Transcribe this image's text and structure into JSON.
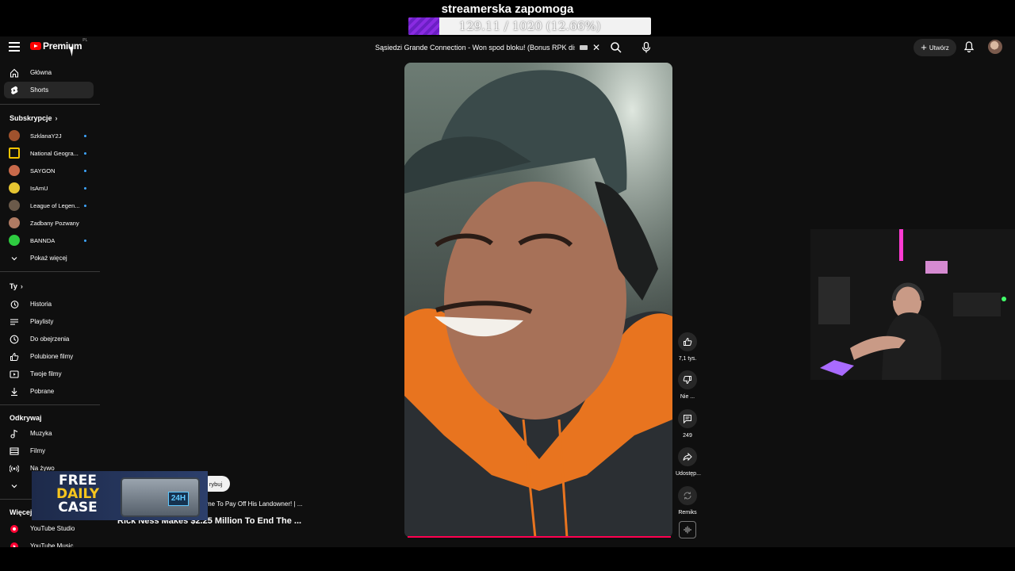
{
  "overlay": {
    "goal_title": "streamerska zapomoga",
    "goal_text": "129.11 / 1020 (12.66%)",
    "goal_progress": 0.1266,
    "fill_color": "#8a2be2"
  },
  "header": {
    "logo_text": "Premium",
    "logo_country": "PL",
    "search_value": "Sąsiedzi Grande Connection - Won spod bloku! (Bonus RPK diss)",
    "clear_symbol": "✕",
    "create_label": "Utwórz",
    "create_plus": "+"
  },
  "sidebar": {
    "main_items": [
      {
        "label": "Główna",
        "icon": "home-icon"
      },
      {
        "label": "Shorts",
        "icon": "shorts-icon",
        "active": true
      }
    ],
    "subs_heading": "Subskrypcje",
    "subscriptions": [
      {
        "name": "SzklanaY2J",
        "color": "#a0522d"
      },
      {
        "name": "National Geogra...",
        "color": "#f5c400"
      },
      {
        "name": "SAYGON",
        "color": "#c96a4a"
      },
      {
        "name": "IsAmU",
        "color": "#e6c531"
      },
      {
        "name": "League of Legen...",
        "color": "#6b5a4a"
      },
      {
        "name": "Zadbany Pozwany",
        "color": "#b07b63"
      },
      {
        "name": "BANNDA",
        "color": "#2ecc40"
      }
    ],
    "show_more": "Pokaż więcej",
    "you_heading": "Ty",
    "you_items": [
      {
        "label": "Historia",
        "icon": "history-icon"
      },
      {
        "label": "Playlisty",
        "icon": "playlist-icon"
      },
      {
        "label": "Do obejrzenia",
        "icon": "watch-later-icon"
      },
      {
        "label": "Polubione filmy",
        "icon": "like-icon"
      },
      {
        "label": "Twoje filmy",
        "icon": "your-videos-icon"
      },
      {
        "label": "Pobrane",
        "icon": "download-icon"
      }
    ],
    "explore_heading": "Odkrywaj",
    "explore_items": [
      {
        "label": "Muzyka",
        "icon": "music-icon"
      },
      {
        "label": "Filmy",
        "icon": "movies-icon"
      },
      {
        "label": "Na żywo",
        "icon": "live-icon"
      }
    ],
    "more_heading": "Więcej",
    "more_items": [
      {
        "label": "YouTube Studio",
        "icon": "yt-studio-icon"
      },
      {
        "label": "YouTube Music",
        "icon": "yt-music-icon"
      }
    ]
  },
  "actions": {
    "likes": "7,1 tys.",
    "dislike": "Nie ...",
    "comments": "249",
    "share": "Udostęp...",
    "remix": "Remiks"
  },
  "related": {
    "subscribe_partial": "rybuj",
    "title1": "me To Pay Off His Landowner! | ...",
    "title2": "Rick Ness Makes $2.25 Million To End The ..."
  },
  "case_banner": {
    "line1": "FREE",
    "line2": "DAILY",
    "line3": "CASE",
    "badge": "24H"
  }
}
